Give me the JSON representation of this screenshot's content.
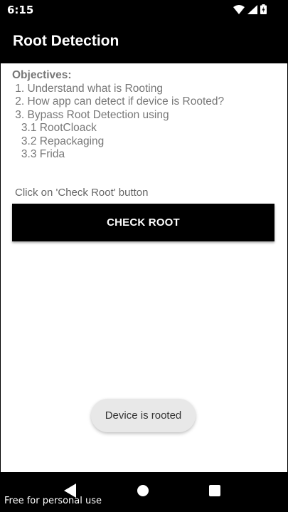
{
  "status_bar": {
    "time": "6:15",
    "icons": [
      "wifi-icon",
      "cell-signal-icon",
      "battery-charging-icon"
    ]
  },
  "app_bar": {
    "title": "Root Detection"
  },
  "objectives": {
    "heading": "Objectives:",
    "lines": [
      " 1. Understand what is Rooting",
      " 2. How app can detect if device is Rooted?",
      " 3. Bypass Root Detection using",
      "   3.1 RootCloack",
      "   3.2 Repackaging",
      "   3.3 Frida"
    ]
  },
  "instruction": "Click on 'Check Root' button",
  "check_button": {
    "label": "CHECK ROOT"
  },
  "toast": {
    "message": "Device is rooted"
  },
  "nav_bar": {
    "icons": [
      "back-icon",
      "home-icon",
      "recents-icon"
    ]
  },
  "watermark": "Free for personal use",
  "colors": {
    "background": "#000000",
    "content": "#ffffff",
    "button": "#000000",
    "toast": "#e8e8e8"
  }
}
